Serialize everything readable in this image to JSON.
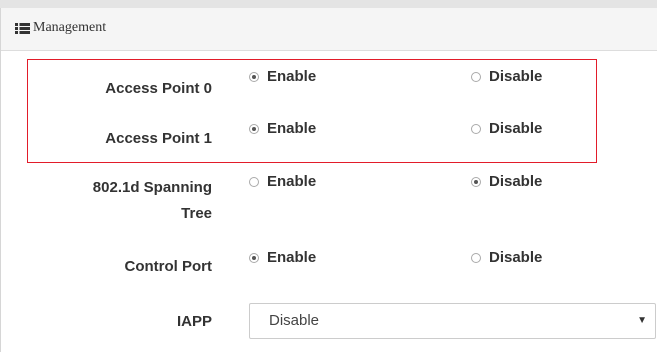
{
  "panel": {
    "title": "Management",
    "icon": "list-icon"
  },
  "rows": [
    {
      "label": "Access Point 0",
      "enable_label": "Enable",
      "disable_label": "Disable",
      "selected": "enable"
    },
    {
      "label": "Access Point 1",
      "enable_label": "Enable",
      "disable_label": "Disable",
      "selected": "enable"
    },
    {
      "label_line1": "802.1d Spanning",
      "label_line2": "Tree",
      "enable_label": "Enable",
      "disable_label": "Disable",
      "selected": "disable"
    },
    {
      "label": "Control Port",
      "enable_label": "Enable",
      "disable_label": "Disable",
      "selected": "enable"
    }
  ],
  "iapp": {
    "label": "IAPP",
    "value": "Disable",
    "arrow": "▼"
  },
  "colors": {
    "highlight_border": "#e21c2a",
    "text": "#333333"
  }
}
